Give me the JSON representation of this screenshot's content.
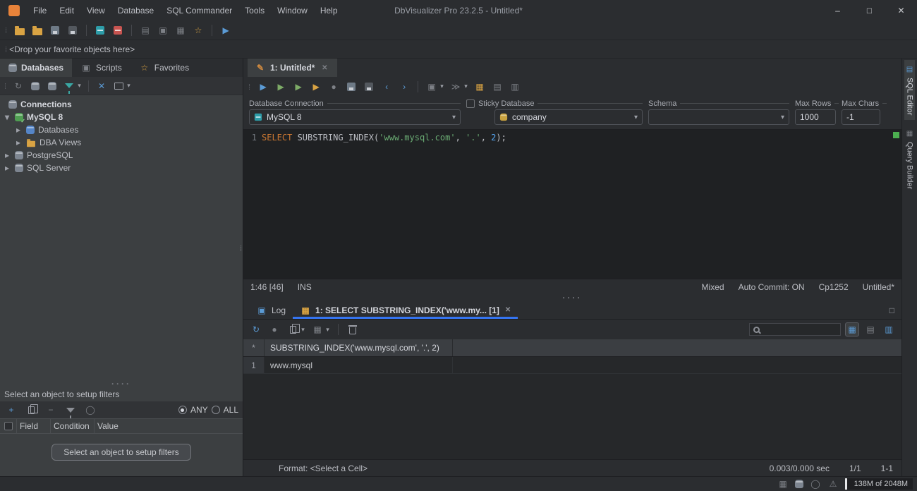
{
  "window": {
    "menus": [
      "File",
      "Edit",
      "View",
      "Database",
      "SQL Commander",
      "Tools",
      "Window",
      "Help"
    ],
    "title": "DbVisualizer Pro 23.2.5 - Untitled*",
    "controls": {
      "minimize": "–",
      "maximize": "□",
      "close": "✕"
    }
  },
  "favorites_bar": {
    "placeholder": "<Drop your favorite objects here>"
  },
  "left_panel": {
    "tabs": [
      {
        "label": "Databases"
      },
      {
        "label": "Scripts"
      },
      {
        "label": "Favorites"
      }
    ],
    "tree": [
      {
        "label": "Connections"
      },
      {
        "label": "MySQL 8"
      },
      {
        "label": "Databases"
      },
      {
        "label": "DBA Views"
      },
      {
        "label": "PostgreSQL"
      },
      {
        "label": "SQL Server"
      }
    ],
    "filters": {
      "hint": "Select an object to setup filters",
      "any": "ANY",
      "all": "ALL",
      "columns": [
        "Field",
        "Condition",
        "Value"
      ],
      "button": "Select an object to setup filters"
    }
  },
  "editor": {
    "tab": "1: Untitled*",
    "connection": {
      "db_conn_label": "Database Connection",
      "db_conn_value": "MySQL 8",
      "sticky_label": "Sticky Database",
      "database_value": "company",
      "schema_label": "Schema",
      "max_rows_label": "Max Rows",
      "max_rows_value": "1000",
      "max_chars_label": "Max Chars",
      "max_chars_value": "-1"
    },
    "code": {
      "line_no": "1",
      "kw": "SELECT",
      "fn": " SUBSTRING_INDEX(",
      "str1": "'www.mysql.com'",
      "sep1": ", ",
      "str2": "'.'",
      "sep2": ", ",
      "num": "2",
      "end": ");"
    },
    "status": {
      "caret": "1:46 [46]",
      "mode": "INS",
      "mixed": "Mixed",
      "autocommit": "Auto Commit: ON",
      "encoding": "Cp1252",
      "file": "Untitled*"
    }
  },
  "results": {
    "tabs": [
      {
        "label": "Log"
      },
      {
        "label": "1: SELECT SUBSTRING_INDEX('www.my... [1]"
      }
    ],
    "grid": {
      "corner": "*",
      "header": "SUBSTRING_INDEX('www.mysql.com', '.', 2)",
      "row_num": "1",
      "row_value": "www.mysql"
    },
    "footer": {
      "format": "Format: <Select a Cell>",
      "timing": "0.003/0.000 sec",
      "rows": "1/1",
      "cell": "1-1"
    }
  },
  "right_strip": {
    "tabs": [
      {
        "label": "SQL Editor"
      },
      {
        "label": "Query Builder"
      }
    ]
  },
  "statusbar": {
    "memory": "138M of 2048M"
  },
  "icons": {
    "run": "▶",
    "stop": "●",
    "back": "‹",
    "forward": "›",
    "refresh": "↻",
    "double_arrow": "≫",
    "chevron_down": "▾",
    "chevron_right": "▸",
    "chevron_expanded": "▾",
    "star": "☆",
    "close": "✕",
    "plus": "+",
    "minus": "−",
    "circle": "◯",
    "warning": "⚠",
    "pencil": "✎",
    "grid": "▦",
    "table": "▤",
    "doc": "▥",
    "script": "▣",
    "pointer": "▶",
    "maximize_panel": "□"
  }
}
